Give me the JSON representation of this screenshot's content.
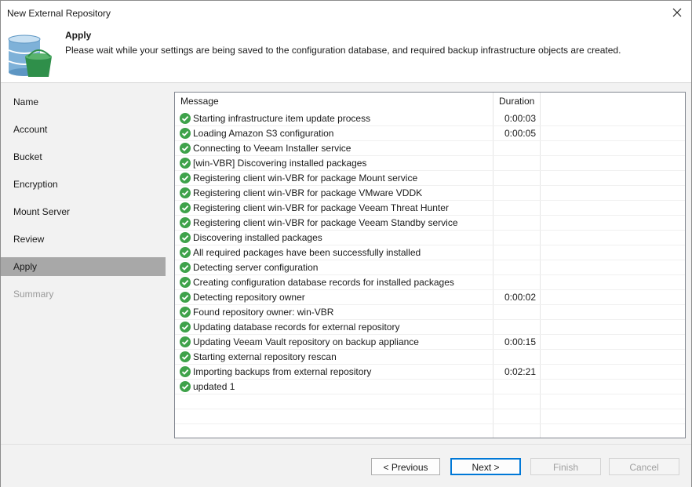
{
  "window": {
    "title": "New External Repository"
  },
  "header": {
    "step_title": "Apply",
    "step_description": "Please wait while your settings are being saved to the configuration database, and required backup infrastructure objects are created.",
    "icon": "database-bucket-icon"
  },
  "sidebar": {
    "items": [
      {
        "label": "Name",
        "state": "normal"
      },
      {
        "label": "Account",
        "state": "normal"
      },
      {
        "label": "Bucket",
        "state": "normal"
      },
      {
        "label": "Encryption",
        "state": "normal"
      },
      {
        "label": "Mount Server",
        "state": "normal"
      },
      {
        "label": "Review",
        "state": "normal"
      },
      {
        "label": "Apply",
        "state": "active"
      },
      {
        "label": "Summary",
        "state": "disabled"
      }
    ]
  },
  "log": {
    "columns": {
      "message": "Message",
      "duration": "Duration"
    },
    "rows": [
      {
        "message": "Starting infrastructure item update process",
        "duration": "0:00:03"
      },
      {
        "message": "Loading Amazon S3 configuration",
        "duration": "0:00:05"
      },
      {
        "message": "Connecting to Veeam Installer service",
        "duration": ""
      },
      {
        "message": "[win-VBR] Discovering installed packages",
        "duration": ""
      },
      {
        "message": "Registering client win-VBR for package Mount service",
        "duration": ""
      },
      {
        "message": "Registering client win-VBR for package VMware VDDK",
        "duration": ""
      },
      {
        "message": "Registering client win-VBR for package Veeam Threat Hunter",
        "duration": ""
      },
      {
        "message": "Registering client win-VBR for package Veeam Standby service",
        "duration": ""
      },
      {
        "message": "Discovering installed packages",
        "duration": ""
      },
      {
        "message": "All required packages have been successfully installed",
        "duration": ""
      },
      {
        "message": "Detecting server configuration",
        "duration": ""
      },
      {
        "message": "Creating configuration database records for installed packages",
        "duration": ""
      },
      {
        "message": "Detecting repository owner",
        "duration": "0:00:02"
      },
      {
        "message": "Found repository owner: win-VBR",
        "duration": ""
      },
      {
        "message": "Updating database records for external repository",
        "duration": ""
      },
      {
        "message": "Updating Veeam Vault repository on backup appliance",
        "duration": "0:00:15"
      },
      {
        "message": "Starting external repository rescan",
        "duration": ""
      },
      {
        "message": "Importing backups from external repository",
        "duration": "0:02:21"
      },
      {
        "message": "updated 1",
        "duration": ""
      }
    ],
    "status_icon": "success-check-icon",
    "status_color": "#3ea24a"
  },
  "buttons": {
    "previous": "< Previous",
    "next": "Next >",
    "finish": "Finish",
    "cancel": "Cancel"
  }
}
